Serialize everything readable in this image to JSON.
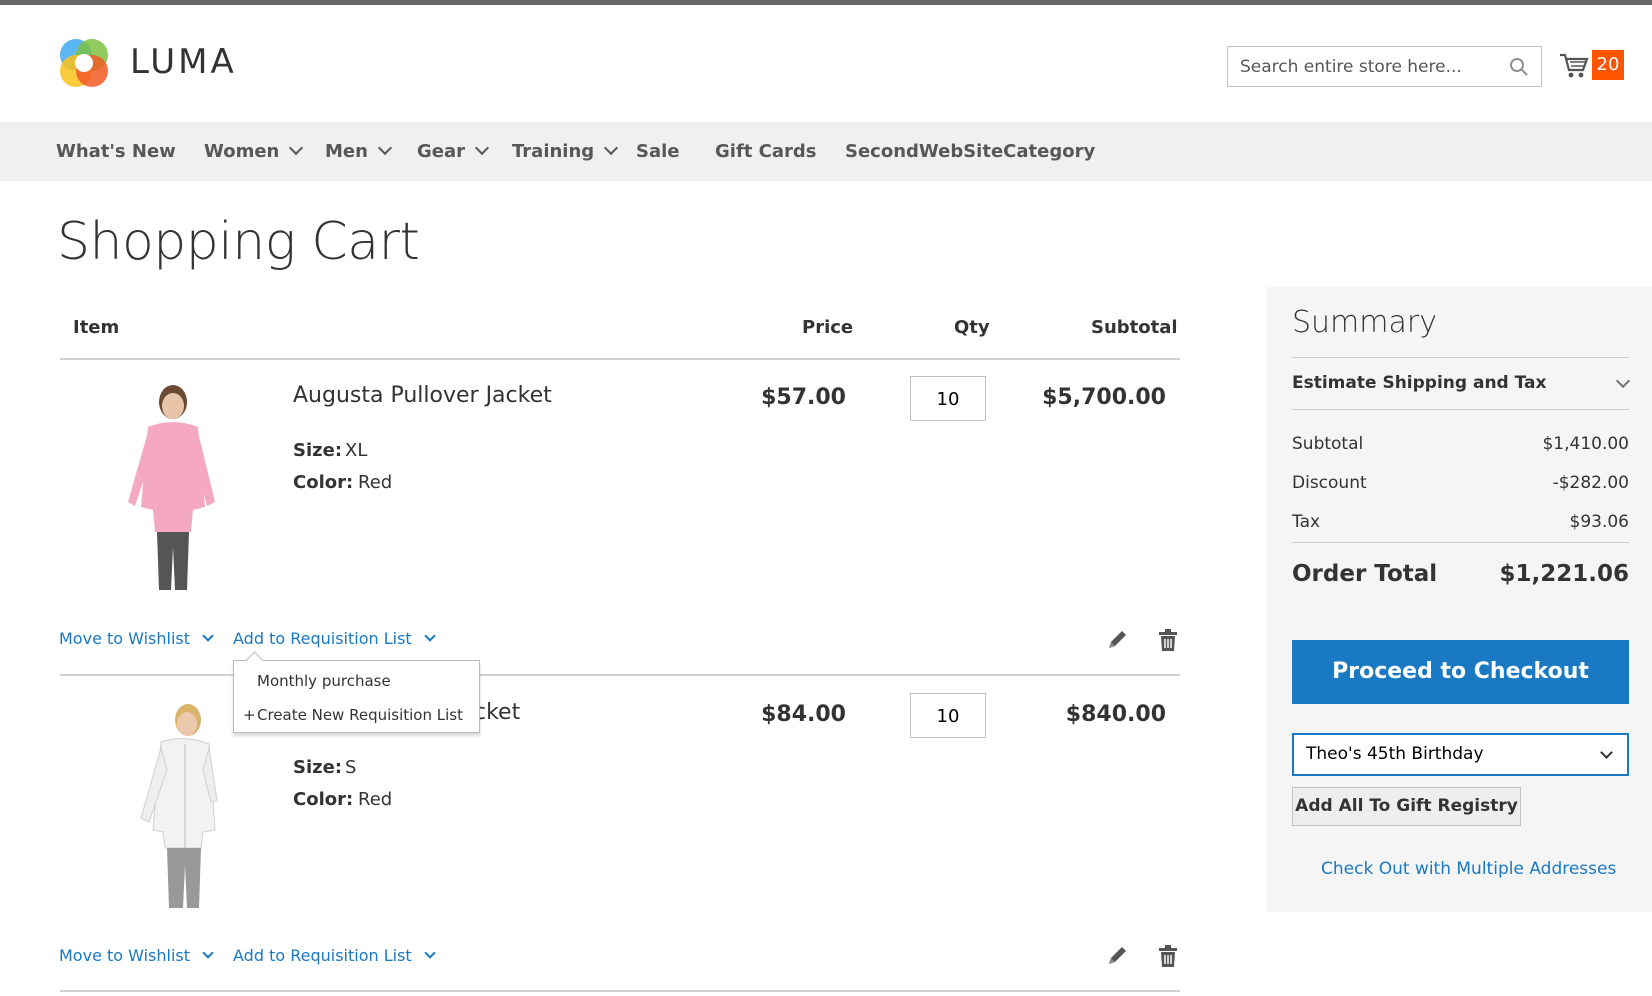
{
  "header": {
    "logo_text": "LUMA",
    "search_placeholder": "Search entire store here...",
    "cart_count": "20",
    "accent_color": "#ff5501"
  },
  "nav": {
    "items": [
      {
        "label": "What's New",
        "has_dropdown": false
      },
      {
        "label": "Women",
        "has_dropdown": true
      },
      {
        "label": "Men",
        "has_dropdown": true
      },
      {
        "label": "Gear",
        "has_dropdown": true
      },
      {
        "label": "Training",
        "has_dropdown": true
      },
      {
        "label": "Sale",
        "has_dropdown": false
      },
      {
        "label": "Gift Cards",
        "has_dropdown": false
      },
      {
        "label": "SecondWebSiteCategory",
        "has_dropdown": false
      }
    ]
  },
  "page": {
    "title": "Shopping Cart"
  },
  "cart": {
    "columns": [
      "Item",
      "Price",
      "Qty",
      "Subtotal"
    ],
    "items": [
      {
        "name": "Augusta Pullover Jacket",
        "size_label": "Size:",
        "size": "XL",
        "color_label": "Color:",
        "color": "Red",
        "price": "$57.00",
        "qty": "10",
        "subtotal": "$5,700.00",
        "wishlist_label": "Move to Wishlist",
        "requisition_label": "Add to Requisition List"
      },
      {
        "name_visible_fragment": "cket",
        "size_label": "Size:",
        "size": "S",
        "color_label": "Color:",
        "color": "Red",
        "price": "$84.00",
        "qty": "10",
        "subtotal": "$840.00",
        "wishlist_label": "Move to Wishlist",
        "requisition_label": "Add to Requisition List"
      }
    ],
    "requisition_dropdown": {
      "items": [
        "Monthly purchase",
        "Create New Requisition List"
      ],
      "plus": "+"
    }
  },
  "summary": {
    "title": "Summary",
    "estimate_label": "Estimate Shipping and Tax",
    "rows": [
      {
        "label": "Subtotal",
        "value": "$1,410.00"
      },
      {
        "label": "Discount",
        "value": "-$282.00"
      },
      {
        "label": "Tax",
        "value": "$93.06"
      }
    ],
    "order_total_label": "Order Total",
    "order_total_value": "$1,221.06",
    "checkout_label": "Proceed to Checkout",
    "registry_selected": "Theo's 45th Birthday",
    "registry_button": "Add All To Gift Registry",
    "multi_address_link": "Check Out with Multiple Addresses",
    "primary_color": "#1979c3"
  }
}
